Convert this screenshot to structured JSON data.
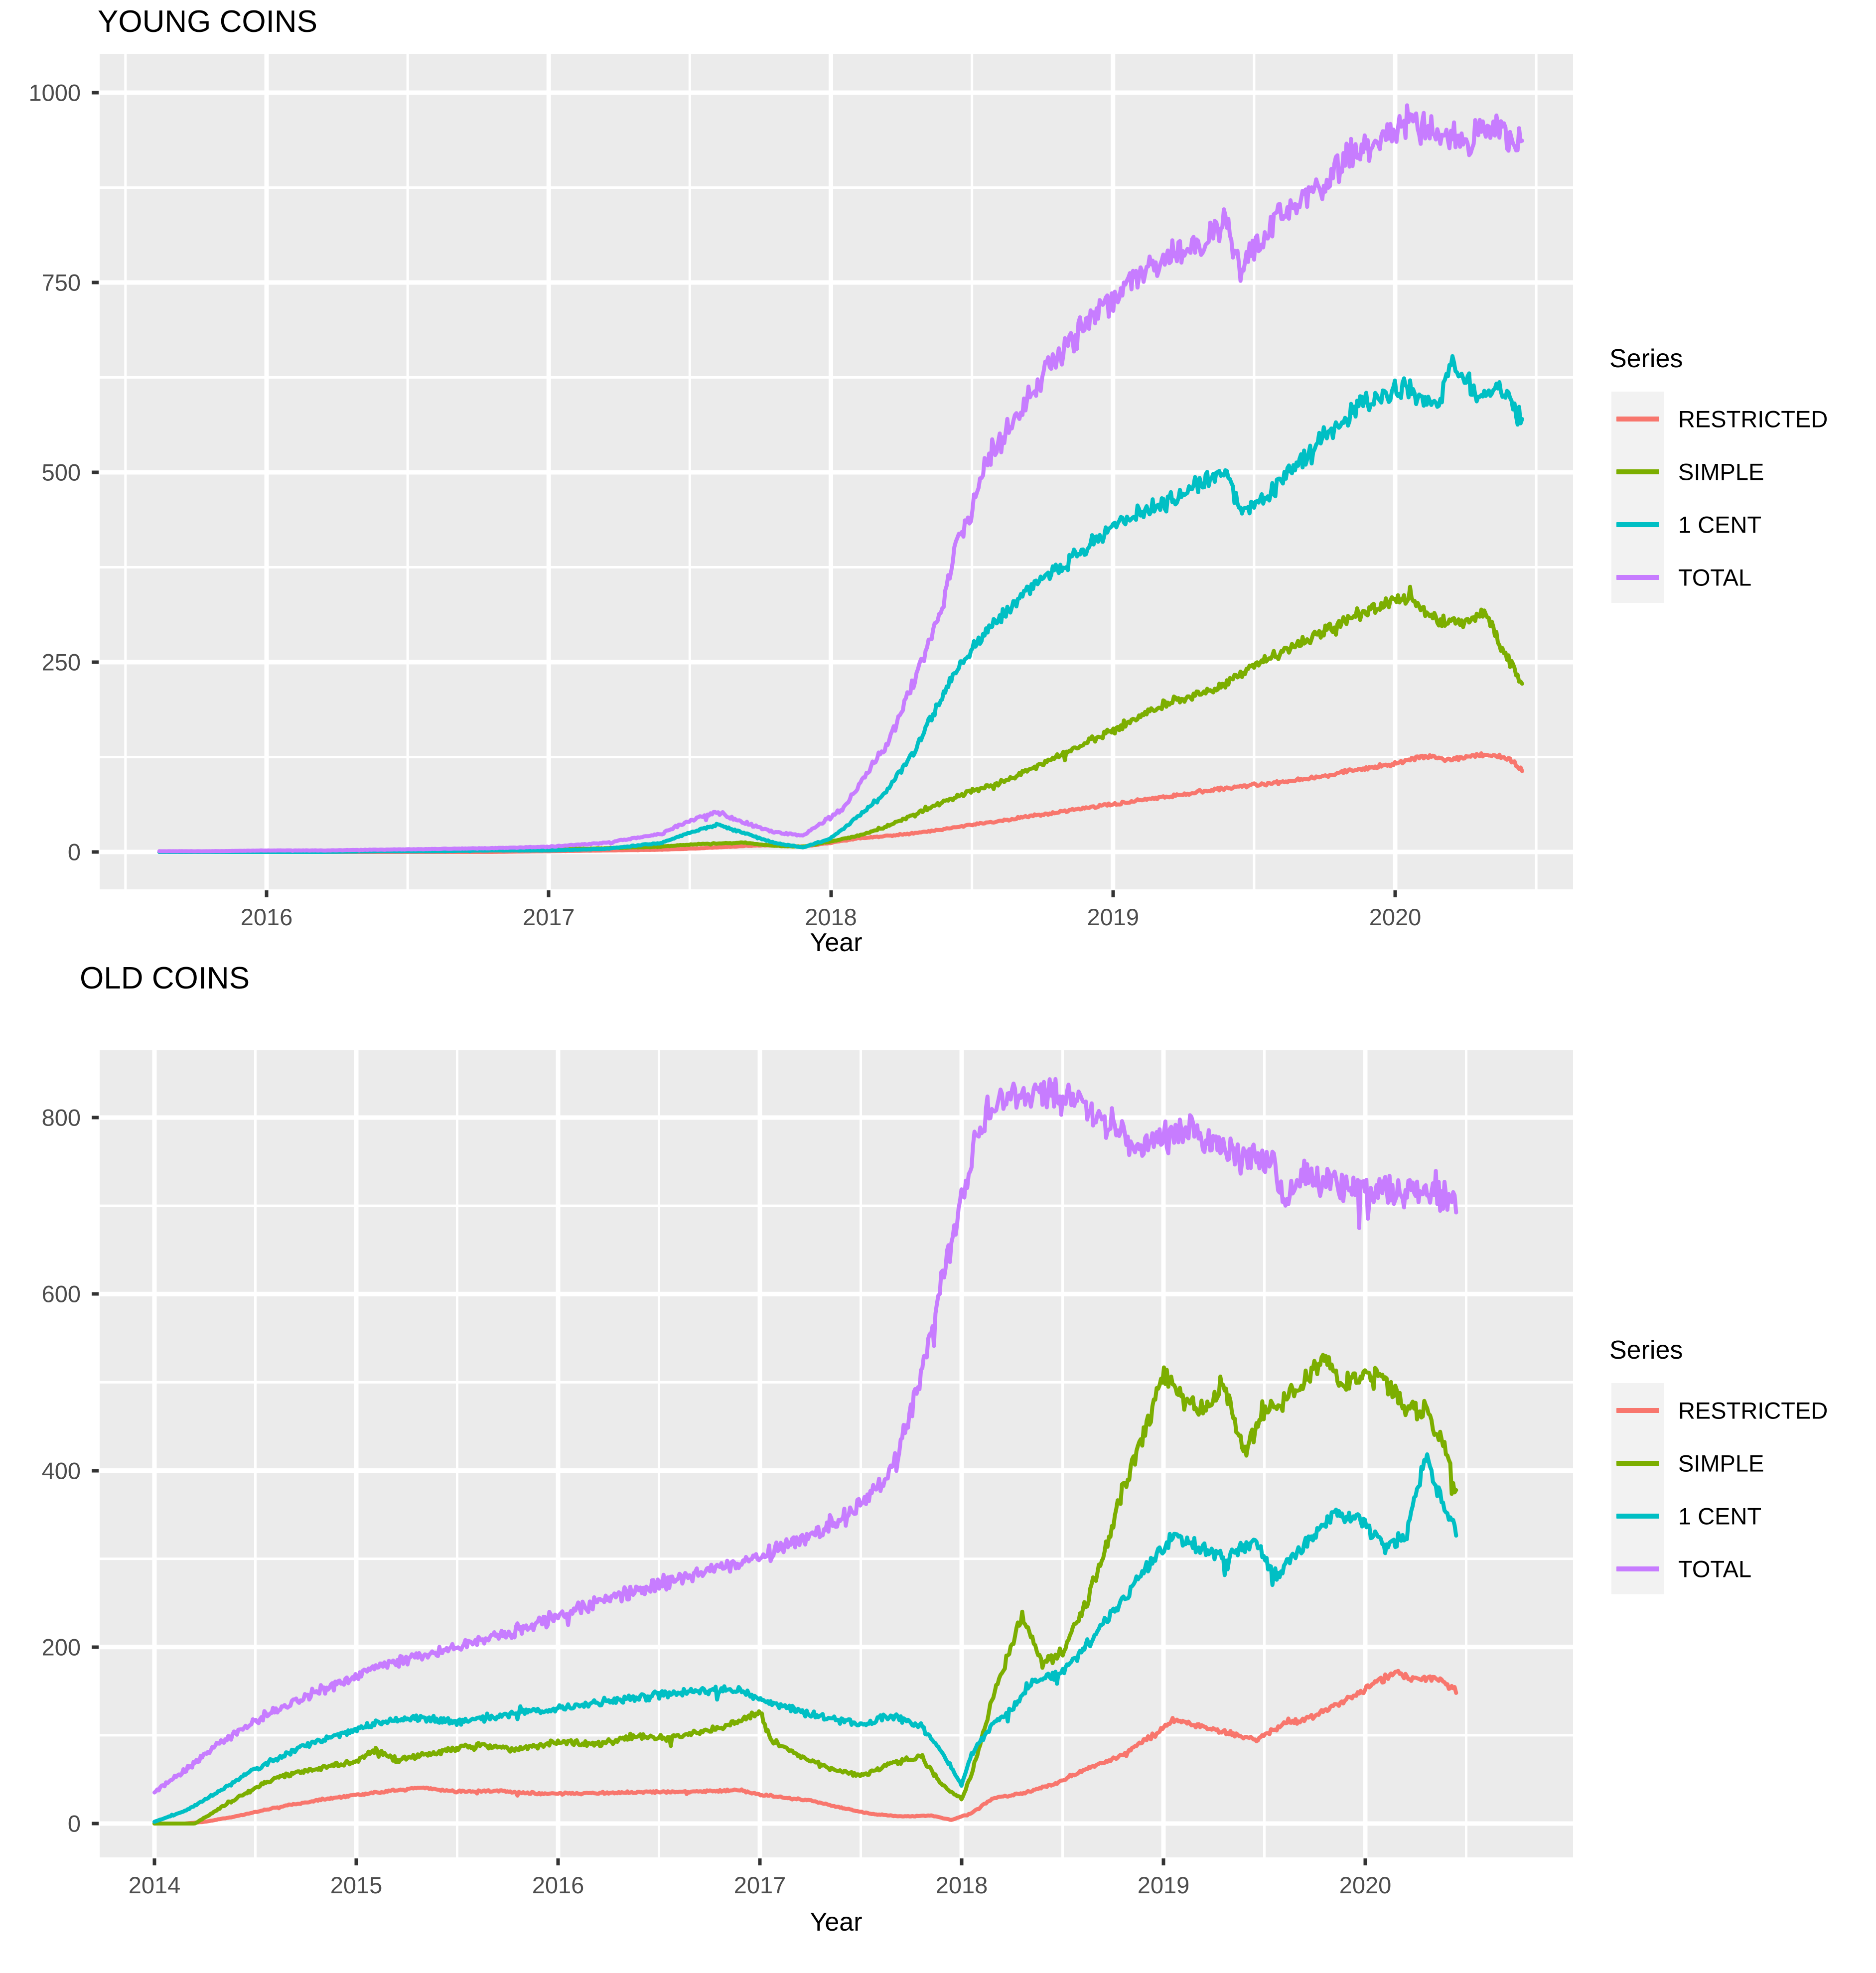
{
  "chart_data": [
    {
      "type": "line",
      "title": "YOUNG COINS",
      "xlabel": "Year",
      "ylabel": "",
      "xlim": [
        2015.6,
        2020.45
      ],
      "ylim": [
        -20,
        1010
      ],
      "xticks": [
        "2016",
        "2017",
        "2018",
        "2019",
        "2020"
      ],
      "xtick_values": [
        2016,
        2017,
        2018,
        2019,
        2020
      ],
      "yticks": [
        "0",
        "250",
        "500",
        "750",
        "1000"
      ],
      "ytick_values": [
        0,
        250,
        500,
        750,
        1000
      ],
      "grid": true,
      "legend_position": "right",
      "legend_title": "Series",
      "series": [
        {
          "name": "RESTRICTED",
          "color": "#F8766D",
          "x": [
            2015.62,
            2015.8,
            2016.0,
            2016.2,
            2016.4,
            2016.6,
            2016.8,
            2017.0,
            2017.2,
            2017.4,
            2017.55,
            2017.7,
            2017.8,
            2017.9,
            2018.0,
            2018.1,
            2018.2,
            2018.3,
            2018.4,
            2018.5,
            2018.6,
            2018.7,
            2018.8,
            2018.9,
            2019.0,
            2019.1,
            2019.2,
            2019.3,
            2019.4,
            2019.5,
            2019.6,
            2019.7,
            2019.8,
            2019.9,
            2020.0,
            2020.1,
            2020.2,
            2020.3,
            2020.4,
            2020.45
          ],
          "y": [
            0,
            0,
            0,
            0,
            0,
            0,
            0,
            1,
            2,
            3,
            5,
            8,
            9,
            7,
            12,
            18,
            21,
            25,
            30,
            36,
            41,
            47,
            52,
            58,
            63,
            68,
            73,
            79,
            84,
            88,
            92,
            97,
            104,
            110,
            117,
            126,
            122,
            128,
            124,
            108
          ]
        },
        {
          "name": "SIMPLE",
          "color": "#7CAE00",
          "x": [
            2015.62,
            2015.8,
            2016.0,
            2016.2,
            2016.4,
            2016.6,
            2016.8,
            2017.0,
            2017.2,
            2017.4,
            2017.55,
            2017.7,
            2017.8,
            2017.9,
            2018.0,
            2018.1,
            2018.2,
            2018.3,
            2018.4,
            2018.5,
            2018.6,
            2018.7,
            2018.8,
            2018.9,
            2019.0,
            2019.1,
            2019.2,
            2019.3,
            2019.4,
            2019.5,
            2019.6,
            2019.7,
            2019.8,
            2019.9,
            2020.0,
            2020.05,
            2020.15,
            2020.25,
            2020.32,
            2020.38,
            2020.45
          ],
          "y": [
            0,
            0,
            0,
            1,
            1,
            2,
            2,
            3,
            5,
            7,
            11,
            12,
            8,
            7,
            14,
            22,
            34,
            50,
            66,
            80,
            91,
            107,
            125,
            143,
            160,
            181,
            198,
            206,
            222,
            246,
            264,
            282,
            301,
            318,
            330,
            335,
            305,
            302,
            318,
            268,
            218
          ]
        },
        {
          "name": "1 CENT",
          "color": "#00BFC4",
          "x": [
            2015.62,
            2015.8,
            2016.0,
            2016.2,
            2016.4,
            2016.6,
            2016.8,
            2017.0,
            2017.2,
            2017.4,
            2017.5,
            2017.6,
            2017.7,
            2017.8,
            2017.9,
            2018.0,
            2018.1,
            2018.2,
            2018.3,
            2018.4,
            2018.5,
            2018.6,
            2018.7,
            2018.8,
            2018.9,
            2019.0,
            2019.1,
            2019.2,
            2019.3,
            2019.4,
            2019.45,
            2019.55,
            2019.65,
            2019.75,
            2019.85,
            2019.95,
            2020.05,
            2020.15,
            2020.2,
            2020.3,
            2020.4,
            2020.45
          ],
          "y": [
            0,
            0,
            0,
            0,
            1,
            1,
            2,
            2,
            4,
            12,
            26,
            36,
            24,
            12,
            6,
            18,
            48,
            80,
            135,
            210,
            268,
            310,
            345,
            372,
            398,
            430,
            448,
            462,
            488,
            500,
            448,
            470,
            510,
            545,
            578,
            602,
            608,
            590,
            642,
            602,
            608,
            562
          ]
        },
        {
          "name": "TOTAL",
          "color": "#C77CFF",
          "x": [
            2015.62,
            2015.8,
            2016.0,
            2016.2,
            2016.4,
            2016.6,
            2016.8,
            2017.0,
            2017.2,
            2017.4,
            2017.5,
            2017.6,
            2017.7,
            2017.8,
            2017.9,
            2018.0,
            2018.05,
            2018.1,
            2018.2,
            2018.3,
            2018.4,
            2018.45,
            2018.5,
            2018.55,
            2018.6,
            2018.7,
            2018.8,
            2018.9,
            2019.0,
            2019.1,
            2019.2,
            2019.3,
            2019.4,
            2019.45,
            2019.55,
            2019.65,
            2019.75,
            2019.85,
            2019.95,
            2020.05,
            2020.15,
            2020.25,
            2020.35,
            2020.45
          ],
          "y": [
            1,
            1,
            2,
            2,
            3,
            4,
            5,
            7,
            12,
            24,
            42,
            52,
            38,
            26,
            22,
            46,
            60,
            90,
            142,
            230,
            330,
            412,
            450,
            512,
            540,
            600,
            650,
            695,
            730,
            765,
            790,
            800,
            835,
            768,
            820,
            855,
            885,
            920,
            945,
            962,
            950,
            938,
            955,
            928
          ]
        }
      ]
    },
    {
      "type": "line",
      "title": "OLD COINS",
      "xlabel": "Year",
      "ylabel": "",
      "xlim": [
        2013.85,
        2020.45
      ],
      "ylim": [
        -30,
        845
      ],
      "xticks": [
        "2014",
        "2015",
        "2016",
        "2017",
        "2018",
        "2019",
        "2020"
      ],
      "xtick_values": [
        2014,
        2015,
        2016,
        2017,
        2018,
        2019,
        2020
      ],
      "yticks": [
        "0",
        "200",
        "400",
        "600",
        "800"
      ],
      "ytick_values": [
        0,
        200,
        400,
        600,
        800
      ],
      "grid": true,
      "legend_position": "right",
      "legend_title": "Series",
      "series": [
        {
          "name": "RESTRICTED",
          "color": "#F8766D",
          "x": [
            2014.0,
            2014.15,
            2014.25,
            2014.4,
            2014.6,
            2014.8,
            2015.0,
            2015.2,
            2015.35,
            2015.5,
            2015.7,
            2015.9,
            2016.1,
            2016.3,
            2016.5,
            2016.7,
            2016.9,
            2017.0,
            2017.1,
            2017.25,
            2017.4,
            2017.55,
            2017.7,
            2017.85,
            2017.95,
            2018.05,
            2018.15,
            2018.3,
            2018.45,
            2018.6,
            2018.8,
            2018.95,
            2019.05,
            2019.15,
            2019.3,
            2019.45,
            2019.6,
            2019.75,
            2019.9,
            2020.05,
            2020.15,
            2020.25,
            2020.35,
            2020.45
          ],
          "y": [
            0,
            0,
            2,
            8,
            18,
            26,
            32,
            38,
            40,
            36,
            37,
            34,
            34,
            35,
            36,
            36,
            38,
            33,
            30,
            26,
            18,
            11,
            8,
            9,
            4,
            12,
            28,
            34,
            44,
            60,
            78,
            100,
            118,
            112,
            104,
            94,
            112,
            122,
            140,
            158,
            172,
            162,
            166,
            150
          ]
        },
        {
          "name": "SIMPLE",
          "color": "#7CAE00",
          "x": [
            2014.0,
            2014.2,
            2014.3,
            2014.45,
            2014.6,
            2014.8,
            2015.0,
            2015.1,
            2015.2,
            2015.35,
            2015.5,
            2015.65,
            2015.8,
            2016.0,
            2016.2,
            2016.4,
            2016.55,
            2016.7,
            2016.85,
            2017.0,
            2017.05,
            2017.2,
            2017.35,
            2017.5,
            2017.65,
            2017.8,
            2017.9,
            2018.0,
            2018.05,
            2018.15,
            2018.3,
            2018.4,
            2018.5,
            2018.6,
            2018.7,
            2018.8,
            2018.9,
            2019.0,
            2019.1,
            2019.2,
            2019.3,
            2019.4,
            2019.5,
            2019.6,
            2019.7,
            2019.8,
            2019.9,
            2020.0,
            2020.1,
            2020.2,
            2020.3,
            2020.4,
            2020.45
          ],
          "y": [
            0,
            0,
            14,
            34,
            52,
            62,
            70,
            84,
            72,
            78,
            86,
            88,
            84,
            92,
            90,
            100,
            96,
            104,
            112,
            126,
            96,
            76,
            62,
            54,
            68,
            76,
            44,
            28,
            56,
            140,
            236,
            180,
            196,
            240,
            300,
            380,
            440,
            512,
            480,
            470,
            500,
            420,
            470,
            480,
            500,
            530,
            496,
            512,
            500,
            472,
            470,
            420,
            372
          ]
        },
        {
          "name": "1 CENT",
          "color": "#00BFC4",
          "x": [
            2014.0,
            2014.15,
            2014.3,
            2014.5,
            2014.7,
            2014.9,
            2015.1,
            2015.3,
            2015.5,
            2015.7,
            2015.9,
            2016.1,
            2016.3,
            2016.5,
            2016.7,
            2016.9,
            2017.0,
            2017.1,
            2017.2,
            2017.35,
            2017.5,
            2017.65,
            2017.8,
            2017.9,
            2018.0,
            2018.05,
            2018.15,
            2018.25,
            2018.35,
            2018.5,
            2018.65,
            2018.8,
            2018.95,
            2019.05,
            2019.15,
            2019.3,
            2019.45,
            2019.55,
            2019.7,
            2019.85,
            2020.0,
            2020.1,
            2020.2,
            2020.3,
            2020.4,
            2020.45
          ],
          "y": [
            2,
            14,
            34,
            62,
            84,
            100,
            114,
            120,
            116,
            122,
            128,
            134,
            140,
            146,
            150,
            152,
            140,
            134,
            126,
            120,
            112,
            122,
            110,
            82,
            44,
            78,
            112,
            130,
            160,
            172,
            210,
            254,
            300,
            326,
            316,
            300,
            320,
            280,
            318,
            352,
            340,
            314,
            324,
            416,
            352,
            332
          ]
        },
        {
          "name": "TOTAL",
          "color": "#C77CFF",
          "x": [
            2014.0,
            2014.15,
            2014.3,
            2014.5,
            2014.7,
            2014.9,
            2015.1,
            2015.3,
            2015.5,
            2015.7,
            2015.9,
            2016.1,
            2016.3,
            2016.5,
            2016.7,
            2016.9,
            2017.0,
            2017.15,
            2017.3,
            2017.45,
            2017.6,
            2017.7,
            2017.8,
            2017.9,
            2018.0,
            2018.05,
            2018.1,
            2018.2,
            2018.3,
            2018.4,
            2018.5,
            2018.6,
            2018.65,
            2018.75,
            2018.85,
            2018.95,
            2019.05,
            2019.15,
            2019.25,
            2019.35,
            2019.45,
            2019.55,
            2019.6,
            2019.7,
            2019.8,
            2019.9,
            2020.0,
            2020.1,
            2020.2,
            2020.3,
            2020.4,
            2020.45
          ],
          "y": [
            35,
            60,
            88,
            116,
            140,
            158,
            176,
            190,
            200,
            212,
            226,
            244,
            258,
            272,
            284,
            296,
            302,
            316,
            332,
            352,
            384,
            430,
            510,
            610,
            700,
            760,
            800,
            822,
            826,
            826,
            822,
            824,
            800,
            790,
            774,
            776,
            780,
            790,
            770,
            756,
            760,
            748,
            710,
            734,
            726,
            722,
            724,
            718,
            712,
            716,
            712,
            706
          ]
        }
      ]
    }
  ],
  "facets": [
    {
      "id": "young",
      "title": "YOUNG COINS",
      "axis_title_x": "Year",
      "legend": {
        "title": "Series",
        "items": [
          {
            "label": "RESTRICTED",
            "color": "#F8766D"
          },
          {
            "label": "SIMPLE",
            "color": "#7CAE00"
          },
          {
            "label": "1 CENT",
            "color": "#00BFC4"
          },
          {
            "label": "TOTAL",
            "color": "#C77CFF"
          }
        ]
      }
    },
    {
      "id": "old",
      "title": "OLD COINS",
      "axis_title_x": "Year",
      "legend": {
        "title": "Series",
        "items": [
          {
            "label": "RESTRICTED",
            "color": "#F8766D"
          },
          {
            "label": "SIMPLE",
            "color": "#7CAE00"
          },
          {
            "label": "1 CENT",
            "color": "#00BFC4"
          },
          {
            "label": "TOTAL",
            "color": "#C77CFF"
          }
        ]
      }
    }
  ],
  "theme": {
    "panel_fill": "#EBEBEB",
    "grid_color": "#FFFFFF",
    "tick_color": "#333333",
    "text_color": "#4D4D4D",
    "legend_key_fill": "#F2F2F2",
    "background": "#FFFFFF"
  }
}
